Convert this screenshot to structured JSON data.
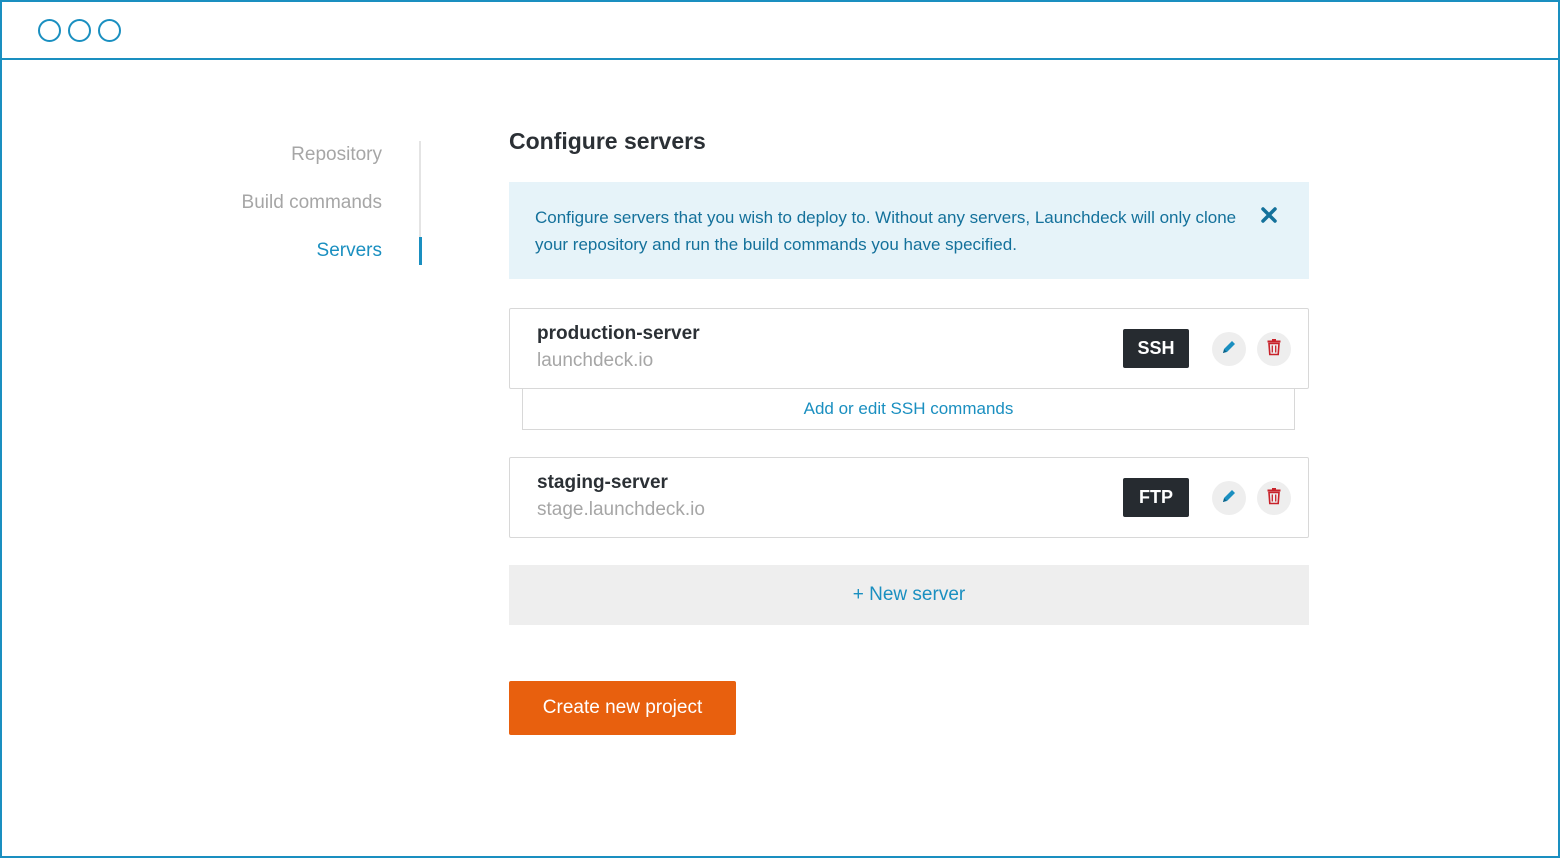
{
  "window": {
    "controls": [
      "circle-icon",
      "circle-icon",
      "circle-icon"
    ]
  },
  "sidebar": {
    "items": [
      {
        "label": "Repository",
        "active": false
      },
      {
        "label": "Build commands",
        "active": false
      },
      {
        "label": "Servers",
        "active": true
      }
    ]
  },
  "main": {
    "title": "Configure servers",
    "notice": {
      "text": "Configure servers that you wish to deploy to. Without any servers, Launchdeck will only clone your repository and run the build commands you have specified.",
      "close_icon": "close-icon"
    },
    "servers": [
      {
        "name": "production-server",
        "host": "launchdeck.io",
        "protocol": "SSH",
        "edit_icon": "pencil-icon",
        "delete_icon": "trash-icon",
        "extra_action": "Add or edit SSH commands"
      },
      {
        "name": "staging-server",
        "host": "stage.launchdeck.io",
        "protocol": "FTP",
        "edit_icon": "pencil-icon",
        "delete_icon": "trash-icon"
      }
    ],
    "new_server_label": "+ New server",
    "create_button_label": "Create new project"
  },
  "colors": {
    "accent": "#1a8fc0",
    "notice_bg": "#e6f3f9",
    "notice_text": "#14719b",
    "badge_bg": "#262b30",
    "primary_button": "#e8600e",
    "danger": "#c8222a",
    "muted_text": "#a6a6a6"
  }
}
